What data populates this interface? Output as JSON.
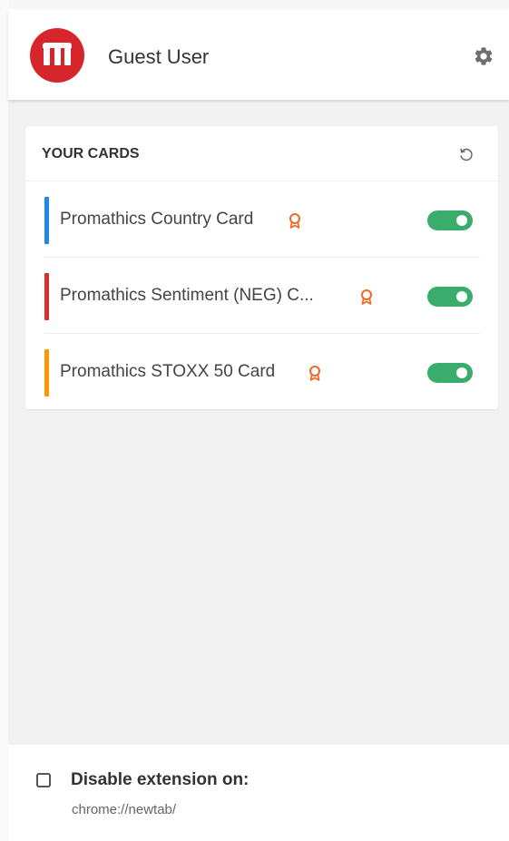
{
  "header": {
    "user_name": "Guest User",
    "logo_icon": "promathics-logo-icon",
    "settings_icon": "gear-icon"
  },
  "cards_panel": {
    "title": "YOUR CARDS",
    "refresh_icon": "refresh-icon",
    "cards": [
      {
        "name": "Promathics Country Card",
        "color": "#1e88e5",
        "badge_icon": "award-badge-icon",
        "enabled": true
      },
      {
        "name": "Promathics Sentiment (NEG) C...",
        "color": "#d32f2f",
        "badge_icon": "award-badge-icon",
        "enabled": true
      },
      {
        "name": "Promathics STOXX 50 Card",
        "color": "#ff9800",
        "badge_icon": "award-badge-icon",
        "enabled": true
      }
    ]
  },
  "footer": {
    "checkbox_label": "Disable extension on:",
    "checkbox_checked": false,
    "url": "chrome://newtab/"
  },
  "colors": {
    "brand_red": "#d7262b",
    "toggle_on": "#3aac6b",
    "badge": "#f26522"
  }
}
